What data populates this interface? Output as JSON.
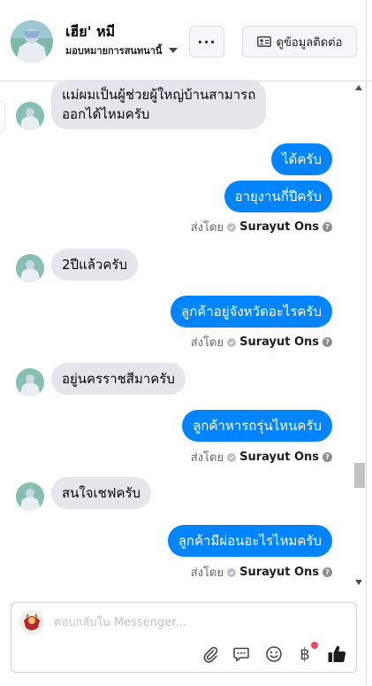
{
  "header": {
    "name": "เฮีย' หมี",
    "assign_label": "มอบหมายการสนทนานี้",
    "more_label": "···",
    "contact_button_label": "ดูข้อมูลติดต่อ"
  },
  "messages": [
    {
      "direction": "in",
      "lines": [
        "แม่ผมเป็นผู้ช่วยผู้ใหญ่บ้านสามารถ",
        "ออกได้ไหมครับ"
      ]
    },
    {
      "direction": "out",
      "text": "ได้ครับ"
    },
    {
      "direction": "out",
      "text": "อายุงานกี่ปีครับ"
    },
    {
      "direction": "in",
      "text": "2ปีแล้วครับ"
    },
    {
      "direction": "out",
      "text": "ลูกค้าอยู่จังหวัดอะไรครับ"
    },
    {
      "direction": "in",
      "text": "อยู่นครราชสีมาครับ"
    },
    {
      "direction": "out",
      "text": "ลูกค้าหารถรุ่นไหนครับ"
    },
    {
      "direction": "in",
      "text": "สนใจเชฟครับ"
    },
    {
      "direction": "out",
      "text": "ลูกค้ามีผ่อนอะไรไหมครับ"
    }
  ],
  "sent_by": {
    "prefix": "ส่งโดย",
    "agent": "Surayut Ons"
  },
  "composer": {
    "placeholder": "ตอบกลับใน Messenger..."
  },
  "icons": {
    "attach": "paperclip-icon",
    "saved_replies": "chat-bubble-icon",
    "emoji": "smiley-icon",
    "payment": "baht-icon",
    "like": "thumbs-up-icon"
  },
  "colors": {
    "outgoing_bubble": "#0084ff",
    "incoming_bubble": "#e4e6eb",
    "notification_dot": "#f3425f"
  }
}
